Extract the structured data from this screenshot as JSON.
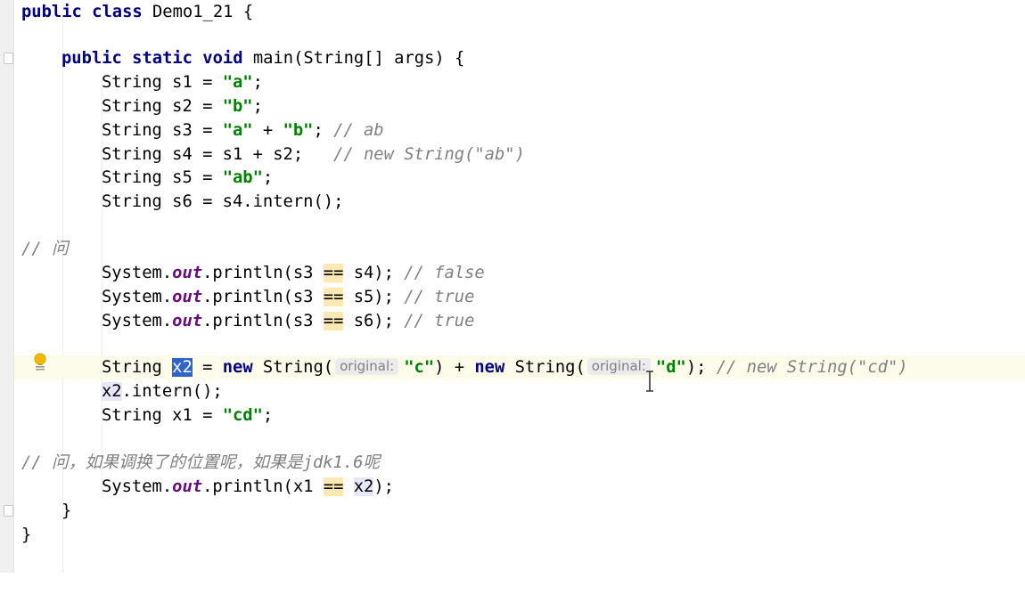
{
  "editor": {
    "file_class_line": {
      "kw": "public class",
      "name": "Demo1_21 {"
    },
    "main_decl": {
      "kw1": "public static void",
      "rest": "main(String[] args) {"
    },
    "s1": {
      "decl": "String s1 = ",
      "lit": "\"a\"",
      "end": ";"
    },
    "s2": {
      "decl": "String s2 = ",
      "lit": "\"b\"",
      "end": ";"
    },
    "s3": {
      "decl": "String s3 = ",
      "lit1": "\"a\"",
      "plus": " + ",
      "lit2": "\"b\"",
      "end": "; ",
      "comment": "// ab"
    },
    "s4": {
      "decl": "String s4 = s1 + s2;   ",
      "comment": "// new String(\"ab\")"
    },
    "s5": {
      "decl": "String s5 = ",
      "lit": "\"ab\"",
      "end": ";"
    },
    "s6": {
      "decl": "String s6 = s4.intern();"
    },
    "comment_q1": "// 问",
    "println1": {
      "sys": "System.",
      "out": "out",
      "pre": ".println(s3 ",
      "eq": "==",
      "post": " s4); ",
      "comment": "// false"
    },
    "println2": {
      "sys": "System.",
      "out": "out",
      "pre": ".println(s3 ",
      "eq": "==",
      "post": " s5); ",
      "comment": "// true"
    },
    "println3": {
      "sys": "System.",
      "out": "out",
      "pre": ".println(s3 ",
      "eq": "==",
      "post": " s6); ",
      "comment": "// true"
    },
    "x2_line": {
      "type": "String ",
      "var": "x2",
      "assign": " = ",
      "new1": "new",
      "ctor1": " String(",
      "hint1": "original:",
      "lit1": "\"c\"",
      "mid": ") + ",
      "new2": "new",
      "ctor2": " String(",
      "hint2": "original:",
      "lit2": "\"d\"",
      "end": "); ",
      "comment": "// new String(\"cd\")"
    },
    "intern_line": {
      "var": "x2",
      "rest": ".intern();"
    },
    "x1_line": {
      "decl": "String x1 = ",
      "lit": "\"cd\"",
      "end": ";"
    },
    "comment_q2": "// 问，如果调换了的位置呢，如果是jdk1.6呢",
    "println4": {
      "sys": "System.",
      "out": "out",
      "pre": ".println(x1 ",
      "eq": "==",
      "mid": " ",
      "var": "x2",
      "end": ");"
    },
    "close_method": "}",
    "close_class": "}"
  },
  "icons": {
    "bulb": "lightbulb-icon",
    "cursor": "text-cursor-icon",
    "fold": "fold-marker-icon"
  },
  "colors": {
    "keyword": "#000080",
    "string": "#008000",
    "comment": "#808080",
    "field": "#660e7a",
    "current_line": "#fdfbe9",
    "selection": "#2f65ca"
  }
}
